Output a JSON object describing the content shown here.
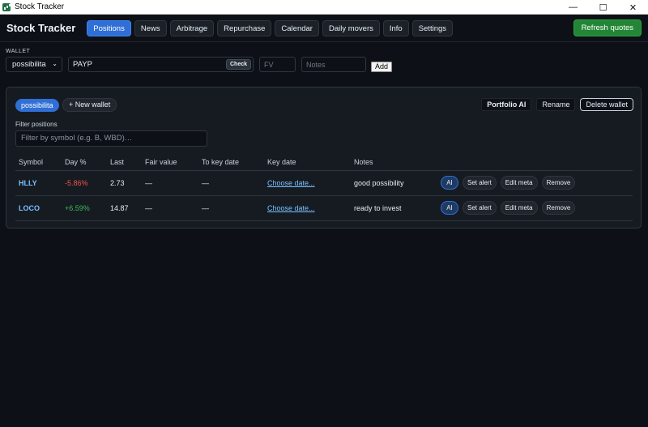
{
  "window": {
    "title": "Stock Tracker",
    "controls": {
      "minimize": "—",
      "maximize": "☐",
      "close": "✕"
    }
  },
  "header": {
    "brand": "Stock Tracker",
    "tabs": [
      {
        "label": "Positions",
        "active": true
      },
      {
        "label": "News",
        "active": false
      },
      {
        "label": "Arbitrage",
        "active": false
      },
      {
        "label": "Repurchase",
        "active": false
      },
      {
        "label": "Calendar",
        "active": false
      },
      {
        "label": "Daily movers",
        "active": false
      },
      {
        "label": "Info",
        "active": false
      },
      {
        "label": "Settings",
        "active": false
      }
    ],
    "refresh_label": "Refresh quotes"
  },
  "wallet_bar": {
    "label": "WALLET",
    "selected_wallet": "possibilita",
    "symbol_value": "PAYP",
    "check_label": "Check",
    "fv_placeholder": "FV",
    "notes_placeholder": "Notes",
    "add_label": "Add"
  },
  "panel": {
    "active_wallet_chip": "possibilita",
    "new_wallet_label": "+ New wallet",
    "actions": {
      "portfolio_ai": "Portfolio AI",
      "rename": "Rename",
      "delete_wallet": "Delete wallet"
    },
    "filter_label": "Filter positions",
    "filter_placeholder": "Filter by symbol (e.g. B, WBD)…",
    "columns": [
      "Symbol",
      "Day %",
      "Last",
      "Fair value",
      "To key date",
      "Key date",
      "Notes",
      ""
    ],
    "rows": [
      {
        "symbol": "HLLY",
        "day_pct": "-5.86%",
        "direction": "down",
        "last": "2.73",
        "fair_value": "—",
        "to_key_date": "—",
        "key_date": "Choose date...",
        "notes": "good possibility"
      },
      {
        "symbol": "LOCO",
        "day_pct": "+6.59%",
        "direction": "up",
        "last": "14.87",
        "fair_value": "—",
        "to_key_date": "—",
        "key_date": "Choose date...",
        "notes": "ready to invest"
      }
    ],
    "row_action_labels": {
      "ai": "AI",
      "set_alert": "Set alert",
      "edit_meta": "Edit meta",
      "remove": "Remove"
    }
  },
  "colors": {
    "background": "#0d1117",
    "accent": "#2f6fd6",
    "refresh": "#238636",
    "negative": "#f85149",
    "positive": "#3fb950",
    "link": "#79c0ff"
  }
}
